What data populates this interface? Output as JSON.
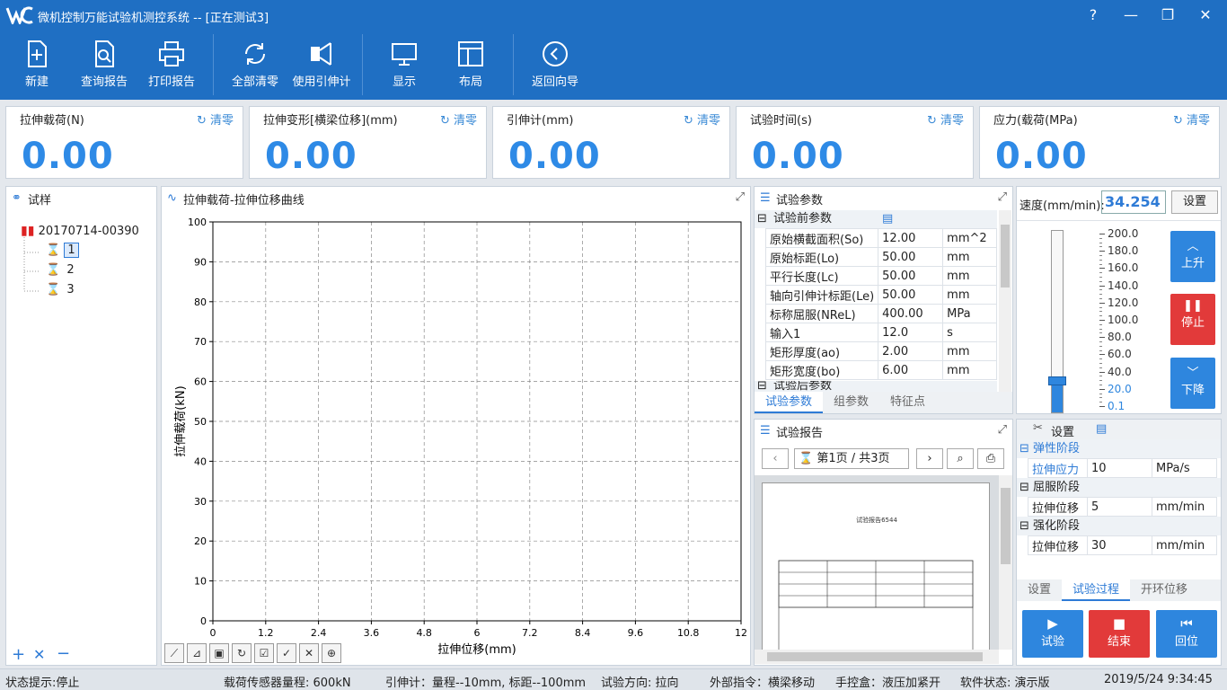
{
  "window": {
    "title": "微机控制万能试验机测控系统 -- [正在测试3]"
  },
  "toolbar": {
    "new": "新建",
    "query_report": "查询报告",
    "print_report": "打印报告",
    "clear_all": "全部清零",
    "use_extensometer": "使用引伸计",
    "display": "显示",
    "layout": "布局",
    "back_wizard": "返回向导"
  },
  "readouts": [
    {
      "label": "拉伸载荷(N)",
      "value": "0.00",
      "clear": "清零"
    },
    {
      "label": "拉伸变形[横梁位移](mm)",
      "value": "0.00",
      "clear": "清零"
    },
    {
      "label": "引伸计(mm)",
      "value": "0.00",
      "clear": "清零"
    },
    {
      "label": "试验时间(s)",
      "value": "0.00",
      "clear": "清零"
    },
    {
      "label": "应力(载荷(MPa)",
      "value": "0.00",
      "clear": "清零"
    }
  ],
  "sample_panel": {
    "title": "试样",
    "root": "20170714-00390",
    "items": [
      "1",
      "2",
      "3"
    ]
  },
  "chart_panel": {
    "title": "拉伸载荷-拉伸位移曲线"
  },
  "chart_data": {
    "type": "line",
    "xlabel": "拉伸位移(mm)",
    "ylabel": "拉伸载荷(kN)",
    "xlim": [
      0,
      12
    ],
    "ylim": [
      0,
      100
    ],
    "xticks": [
      "0",
      "1.2",
      "2.4",
      "3.6",
      "4.8",
      "6",
      "7.2",
      "8.4",
      "9.6",
      "10.8",
      "12"
    ],
    "yticks": [
      "0",
      "10",
      "20",
      "30",
      "40",
      "50",
      "60",
      "70",
      "80",
      "90",
      "100"
    ],
    "grid": true,
    "series": []
  },
  "params_panel": {
    "title": "试验参数",
    "group_pre": "试验前参数",
    "group_post": "试验后参数",
    "rows": [
      {
        "name": "原始横截面积(So)",
        "value": "12.00",
        "unit": "mm^2"
      },
      {
        "name": "原始标距(Lo)",
        "value": "50.00",
        "unit": "mm"
      },
      {
        "name": "平行长度(Lc)",
        "value": "50.00",
        "unit": "mm"
      },
      {
        "name": "轴向引伸计标距(Le)",
        "value": "50.00",
        "unit": "mm"
      },
      {
        "name": "标称屈服(NReL)",
        "value": "400.00",
        "unit": "MPa"
      },
      {
        "name": "输入1",
        "value": "12.0",
        "unit": "s"
      },
      {
        "name": "矩形厚度(ao)",
        "value": "2.00",
        "unit": "mm"
      },
      {
        "name": "矩形宽度(bo)",
        "value": "6.00",
        "unit": "mm"
      }
    ],
    "tabs": [
      "试验参数",
      "组参数",
      "特征点"
    ]
  },
  "report_panel": {
    "title": "试验报告",
    "page": "第1页 / 共3页",
    "doc_title": "试验报告6544"
  },
  "speed": {
    "label": "速度(mm/min):",
    "value": "34.254",
    "set": "设置",
    "scale": [
      "200.0",
      "180.0",
      "160.0",
      "140.0",
      "120.0",
      "100.0",
      "80.0",
      "60.0",
      "40.0",
      "20.0",
      "0.1"
    ],
    "level": 0.171,
    "up": "上升",
    "stop": "停止",
    "down": "下降"
  },
  "process_panel": {
    "settings": "设置",
    "groups": [
      {
        "name": "弹性阶段",
        "param": "拉伸应力",
        "value": "10",
        "unit": "MPa/s"
      },
      {
        "name": "屈服阶段",
        "param": "拉伸位移",
        "value": "5",
        "unit": "mm/min"
      },
      {
        "name": "强化阶段",
        "param": "拉伸位移",
        "value": "30",
        "unit": "mm/min"
      }
    ],
    "tabs": [
      "设置",
      "试验过程",
      "开环位移"
    ]
  },
  "controls": {
    "test": "试验",
    "end": "结束",
    "return": "回位"
  },
  "status": {
    "hint": "状态提示:停止",
    "sensor": "载荷传感器量程: 600kN",
    "ext": "引伸计：量程--10mm, 标距--100mm",
    "direction": "试验方向: 拉向",
    "cmd": "外部指令：横梁移动",
    "box": "手控盒：液压加紧开",
    "soft": "软件状态: 演示版",
    "time": "2019/5/24 9:34:45"
  },
  "colors": {
    "brand": "#1f6fc3",
    "value": "#2e8ae6",
    "stop": "#e23a3a",
    "action": "#2e86de"
  }
}
